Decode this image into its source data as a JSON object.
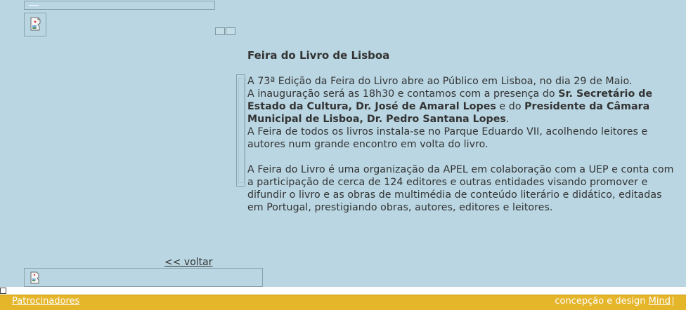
{
  "article": {
    "title": "Feira do Livro de Lisboa",
    "p1_line1": "A 73ª Edição da Feira do Livro abre ao Público em Lisboa, no dia 29 de Maio.",
    "p1_inaug_pre": "A inauguração será as 18h30 e contamos com a presença do ",
    "p1_secretario": "Sr. Secretário de Estado da Cultura, Dr. José de Amaral Lopes",
    "p1_and": " e do ",
    "p1_presidente": "Presidente da Câmara Municipal de Lisboa, Dr. Pedro Santana Lopes",
    "p1_period": ".",
    "p1_line_last": "A Feira de todos os livros instala-se no Parque Eduardo VII, acolhendo leitores e autores num grande encontro em volta do livro.",
    "p2": "A Feira do Livro é uma organização da APEL em colaboração com a UEP e conta com a participação de cerca de 124 editores e outras entidades visando promover e difundir o livro e as obras de multimédia de conteúdo literário e didático, editadas em Portugal, prestigiando obras, autores, editores e leitores."
  },
  "nav": {
    "back_label": "<< voltar"
  },
  "footer": {
    "sponsors_label": "Patrocinadores",
    "credit_prefix": "concepção e design ",
    "credit_link": "Mind"
  },
  "icons": {
    "top_image": "broken-image-icon",
    "bottom_image": "broken-image-icon"
  },
  "colors": {
    "background": "#b9d6e2",
    "footer_bar": "#e5b52a",
    "text": "#333333"
  }
}
